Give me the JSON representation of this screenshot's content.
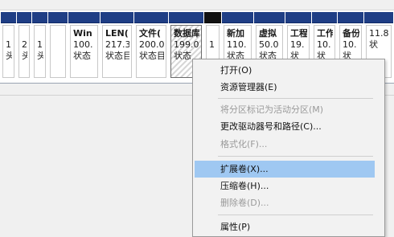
{
  "partitions": [
    {
      "lines": [
        "1(",
        "头"
      ]
    },
    {
      "lines": [
        "2",
        "头"
      ]
    },
    {
      "lines": [
        "1(",
        "头"
      ]
    },
    {
      "lines": [
        "Win",
        "100.",
        "状态"
      ]
    },
    {
      "lines": [
        "LEN(",
        "217.3",
        "状态目"
      ]
    },
    {
      "lines": [
        "文件(",
        "200.0",
        "状态目"
      ]
    },
    {
      "lines": [
        "数据库",
        "199.0",
        "状态"
      ]
    },
    {
      "lines": [
        "1"
      ]
    },
    {
      "lines": [
        "新加",
        "110.",
        "状态"
      ]
    },
    {
      "lines": [
        "虚拟",
        "50.0",
        "状态"
      ]
    },
    {
      "lines": [
        "工程",
        "19.",
        "状"
      ]
    },
    {
      "lines": [
        "工作",
        "10.",
        "状"
      ]
    },
    {
      "lines": [
        "备份",
        "10.",
        "状"
      ]
    },
    {
      "lines": [
        "",
        "11.8",
        "状"
      ]
    }
  ],
  "context_menu": {
    "items": [
      {
        "label": "打开(O)",
        "enabled": true
      },
      {
        "label": "资源管理器(E)",
        "enabled": true
      },
      {
        "label": "将分区标记为活动分区(M)",
        "enabled": false
      },
      {
        "label": "更改驱动器号和路径(C)...",
        "enabled": true
      },
      {
        "label": "格式化(F)...",
        "enabled": false
      },
      {
        "label": "扩展卷(X)...",
        "enabled": true,
        "highlighted": true
      },
      {
        "label": "压缩卷(H)...",
        "enabled": true
      },
      {
        "label": "删除卷(D)...",
        "enabled": false
      },
      {
        "label": "属性(P)",
        "enabled": true
      }
    ]
  },
  "colors": {
    "partition_bar": "#1f3e85",
    "unallocated_bar": "#111111",
    "menu_highlight": "#9fc8f2"
  }
}
